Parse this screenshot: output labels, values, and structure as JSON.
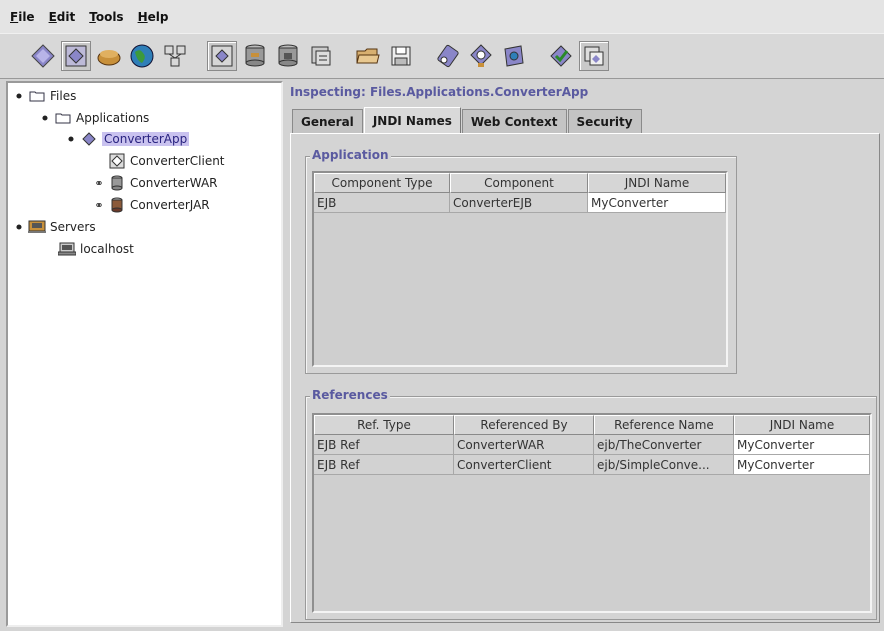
{
  "menu": [
    {
      "pre": "",
      "mn": "F",
      "post": "ile"
    },
    {
      "pre": "",
      "mn": "E",
      "post": "dit"
    },
    {
      "pre": "",
      "mn": "T",
      "post": "ools"
    },
    {
      "pre": "",
      "mn": "H",
      "post": "elp"
    }
  ],
  "toolbar": {
    "icons": [
      "new-application-icon",
      "new-application-client-icon",
      "new-component-icon",
      "new-web-component-icon",
      "new-enterprise-bean-icon",
      "deploy-icon",
      "add-server-icon",
      "remove-server-icon",
      "update-files-icon",
      "open-icon",
      "save-icon",
      "verify-icon",
      "inspect-icon",
      "jar-icon",
      "ok-icon",
      "security-icon"
    ]
  },
  "tree": {
    "files": "Files",
    "applications": "Applications",
    "converter_app": "ConverterApp",
    "converter_client": "ConverterClient",
    "converter_war": "ConverterWAR",
    "converter_jar": "ConverterJAR",
    "servers": "Servers",
    "localhost": "localhost"
  },
  "inspector": {
    "title": "Inspecting: Files.Applications.ConverterApp",
    "tabs": [
      "General",
      "JNDI Names",
      "Web Context",
      "Security"
    ],
    "active_tab": "JNDI Names"
  },
  "application": {
    "title": "Application",
    "columns": [
      "Component Type",
      "Component",
      "JNDI Name"
    ],
    "rows": [
      [
        "EJB",
        "ConverterEJB",
        "MyConverter"
      ]
    ]
  },
  "references": {
    "title": "References",
    "columns": [
      "Ref. Type",
      "Referenced By",
      "Reference Name",
      "JNDI Name"
    ],
    "rows": [
      [
        "EJB Ref",
        "ConverterWAR",
        "ejb/TheConverter",
        "MyConverter"
      ],
      [
        "EJB Ref",
        "ConverterClient",
        "ejb/SimpleConve...",
        "MyConverter"
      ]
    ]
  },
  "colors": {
    "selection": "#c9c2ef",
    "group_title": "#5a5aa0",
    "panel": "#d4d4d4"
  }
}
